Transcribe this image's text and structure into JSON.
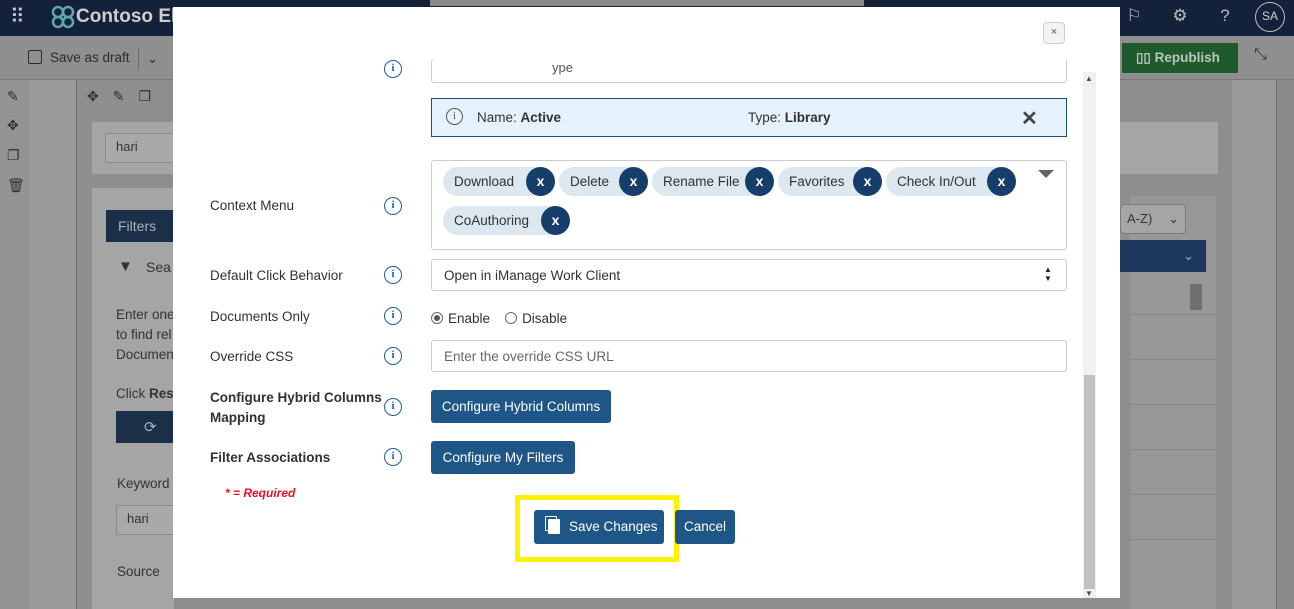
{
  "app": {
    "brand": "Contoso Ele",
    "avatar_initials": "SA",
    "command_bar": {
      "save_as_draft": "Save as draft",
      "republish": "Republish"
    }
  },
  "background": {
    "search_value_top": "hari",
    "filters_tab": "Filters",
    "search_heading_partial": "Sea",
    "help_line_1": "Enter one",
    "help_line_2": "to find rel",
    "help_line_3": "Documen",
    "click_text": "Click",
    "click_bold": "Rese",
    "keyword_label": "Keyword",
    "keyword_value": "hari",
    "source_label": "Source",
    "sort_select_partial": "A-Z)"
  },
  "modal": {
    "close_label": "×",
    "partial_field_text": "ype",
    "active_item": {
      "name_label": "Name:",
      "name_value": "Active",
      "type_label": "Type:",
      "type_value": "Library",
      "remove": "✕"
    },
    "context_menu": {
      "label": "Context Menu",
      "chips": [
        "Download",
        "Delete",
        "Rename File",
        "Favorites",
        "Check In/Out",
        "CoAuthoring"
      ],
      "chip_remove": "x"
    },
    "default_click": {
      "label": "Default Click Behavior",
      "value": "Open in iManage Work Client"
    },
    "documents_only": {
      "label": "Documents Only",
      "options": [
        "Enable",
        "Disable"
      ],
      "selected": "Enable"
    },
    "override_css": {
      "label": "Override CSS",
      "placeholder": "Enter the override CSS URL",
      "value": ""
    },
    "hybrid_columns": {
      "label_line1": "Configure Hybrid Columns",
      "label_line2": "Mapping",
      "button": "Configure Hybrid Columns"
    },
    "filter_associations": {
      "label": "Filter Associations",
      "button": "Configure My Filters"
    },
    "required_note": "* = Required",
    "footer": {
      "save": "Save Changes",
      "cancel": "Cancel"
    }
  },
  "colors": {
    "primary_button": "#1d5687",
    "chip_remove_bg": "#163e6b",
    "highlight": "#fff200",
    "required_text": "#e81123",
    "info_icon": "#1b5fa7"
  }
}
